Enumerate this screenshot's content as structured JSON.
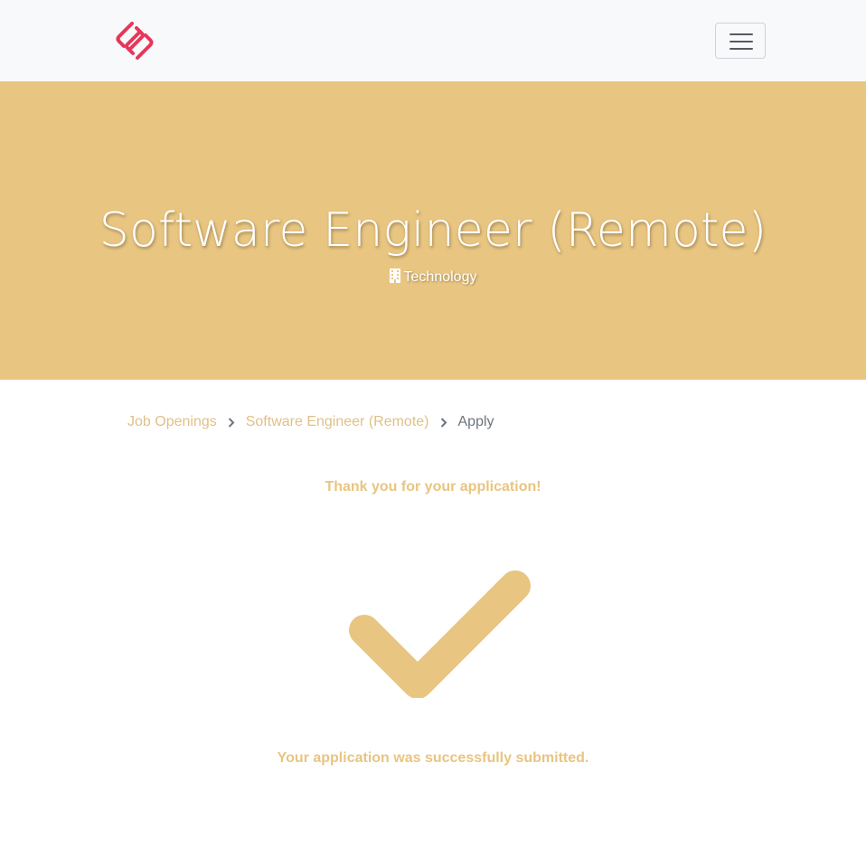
{
  "header": {
    "logo_icon": "link-logo-icon",
    "logo_color": "#e6375a",
    "menu_icon": "hamburger-menu-icon"
  },
  "hero": {
    "title": "Software Engineer (Remote)",
    "department": "Technology",
    "department_icon": "building-icon",
    "background_color": "#e8c580"
  },
  "breadcrumb": {
    "items": [
      {
        "label": "Job Openings"
      },
      {
        "label": "Software Engineer (Remote)"
      },
      {
        "label": "Apply"
      }
    ],
    "separator_icon": "chevron-right-icon"
  },
  "confirmation": {
    "heading": "Thank you for your application!",
    "icon": "checkmark-icon",
    "message": "Your application was successfully submitted.",
    "accent_color": "#e8c580"
  }
}
